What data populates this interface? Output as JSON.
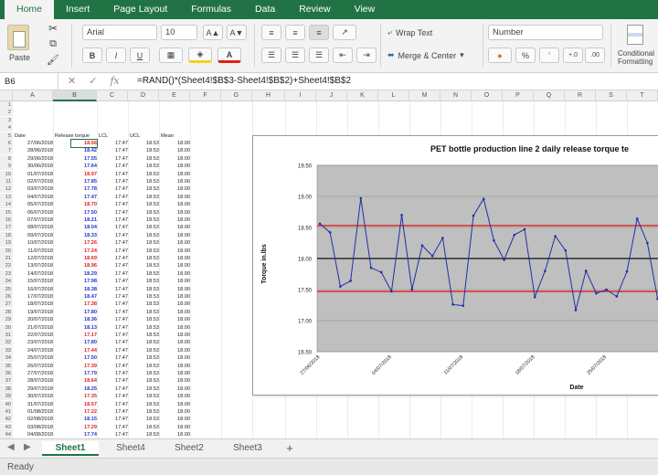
{
  "ribbon_tabs": [
    "Home",
    "Insert",
    "Page Layout",
    "Formulas",
    "Data",
    "Review",
    "View"
  ],
  "ribbon": {
    "paste": "Paste",
    "font": "Arial",
    "size": "10",
    "wrap": "Wrap Text",
    "merge": "Merge & Center",
    "numfmt": "Number",
    "cond": "Conditional Formatting",
    "bold": "B",
    "italic": "I",
    "underline": "U",
    "inc_font": "A▲",
    "dec_font": "A▼",
    "percent": "%",
    "comma": "’"
  },
  "namebox": "B6",
  "formula": "=RAND()*(Sheet4!$B$3-Sheet4!$B$2)+Sheet4!$B$2",
  "columns": [
    "A",
    "B",
    "C",
    "D",
    "E",
    "F",
    "G",
    "H",
    "I",
    "J",
    "K",
    "L",
    "M",
    "N",
    "O",
    "P",
    "Q",
    "R",
    "S",
    "T"
  ],
  "headers": {
    "date": "Date",
    "torque": "Release torque",
    "lcl": "LCL",
    "ucl": "UCL",
    "mean": "Mean"
  },
  "lcl": "17.47",
  "ucl": "18.53",
  "mean": "18.00",
  "rows": [
    {
      "date": "27/06/2018",
      "v": "18.56",
      "red": true
    },
    {
      "date": "28/06/2018",
      "v": "18.42",
      "red": false
    },
    {
      "date": "29/06/2018",
      "v": "17.55",
      "red": false
    },
    {
      "date": "30/06/2018",
      "v": "17.64",
      "red": false
    },
    {
      "date": "01/07/2018",
      "v": "18.97",
      "red": true
    },
    {
      "date": "02/07/2018",
      "v": "17.85",
      "red": false
    },
    {
      "date": "03/07/2018",
      "v": "17.78",
      "red": false
    },
    {
      "date": "04/07/2018",
      "v": "17.47",
      "red": false
    },
    {
      "date": "05/07/2018",
      "v": "18.70",
      "red": true
    },
    {
      "date": "06/07/2018",
      "v": "17.50",
      "red": false
    },
    {
      "date": "07/07/2018",
      "v": "18.21",
      "red": false
    },
    {
      "date": "08/07/2018",
      "v": "18.04",
      "red": false
    },
    {
      "date": "09/07/2018",
      "v": "18.33",
      "red": false
    },
    {
      "date": "10/07/2018",
      "v": "17.26",
      "red": true
    },
    {
      "date": "11/07/2018",
      "v": "17.24",
      "red": true
    },
    {
      "date": "12/07/2018",
      "v": "18.69",
      "red": true
    },
    {
      "date": "13/07/2018",
      "v": "18.96",
      "red": true
    },
    {
      "date": "14/07/2018",
      "v": "18.29",
      "red": false
    },
    {
      "date": "15/07/2018",
      "v": "17.98",
      "red": false
    },
    {
      "date": "16/07/2018",
      "v": "18.38",
      "red": false
    },
    {
      "date": "17/07/2018",
      "v": "18.47",
      "red": false
    },
    {
      "date": "18/07/2018",
      "v": "17.38",
      "red": true
    },
    {
      "date": "19/07/2018",
      "v": "17.80",
      "red": false
    },
    {
      "date": "20/07/2018",
      "v": "18.36",
      "red": false
    },
    {
      "date": "21/07/2018",
      "v": "18.13",
      "red": false
    },
    {
      "date": "22/07/2018",
      "v": "17.17",
      "red": true
    },
    {
      "date": "23/07/2018",
      "v": "17.80",
      "red": false
    },
    {
      "date": "24/07/2018",
      "v": "17.44",
      "red": true
    },
    {
      "date": "25/07/2018",
      "v": "17.50",
      "red": false
    },
    {
      "date": "26/07/2018",
      "v": "17.39",
      "red": true
    },
    {
      "date": "27/07/2018",
      "v": "17.79",
      "red": false
    },
    {
      "date": "28/07/2018",
      "v": "18.64",
      "red": true
    },
    {
      "date": "29/07/2018",
      "v": "18.25",
      "red": false
    },
    {
      "date": "30/07/2018",
      "v": "17.35",
      "red": true
    },
    {
      "date": "31/07/2018",
      "v": "18.57",
      "red": true
    },
    {
      "date": "01/08/2018",
      "v": "17.22",
      "red": true
    },
    {
      "date": "02/08/2018",
      "v": "18.15",
      "red": false
    },
    {
      "date": "03/08/2018",
      "v": "17.29",
      "red": true
    },
    {
      "date": "04/08/2018",
      "v": "17.74",
      "red": false
    }
  ],
  "chart_data": {
    "type": "line",
    "title": "PET bottle production line 2 daily release torque te",
    "xlabel": "Date",
    "ylabel": "Torque in.lbs",
    "ylim": [
      16.5,
      19.5
    ],
    "yticks": [
      "19.50",
      "19.00",
      "18.50",
      "18.00",
      "17.50",
      "17.00",
      "16.50"
    ],
    "xticks": [
      "27/06/2018",
      "04/07/2018",
      "11/07/2018",
      "18/07/2018",
      "25/07/2018"
    ],
    "series": [
      {
        "values": [
          18.56,
          18.42,
          17.55,
          17.64,
          18.97,
          17.85,
          17.78,
          17.47,
          18.7,
          17.5,
          18.21,
          18.04,
          18.33,
          17.26,
          17.24,
          18.69,
          18.96,
          18.29,
          17.98,
          18.38,
          18.47,
          17.38,
          17.8,
          18.36,
          18.13,
          17.17,
          17.8,
          17.44,
          17.5,
          17.39,
          17.79,
          18.64,
          18.25,
          17.35
        ]
      }
    ],
    "lcl": 17.47,
    "ucl": 18.53,
    "mean": 18.0
  },
  "sheets": [
    "Sheet1",
    "Sheet4",
    "Sheet2",
    "Sheet3"
  ],
  "add_sheet": "+",
  "status": "Ready"
}
